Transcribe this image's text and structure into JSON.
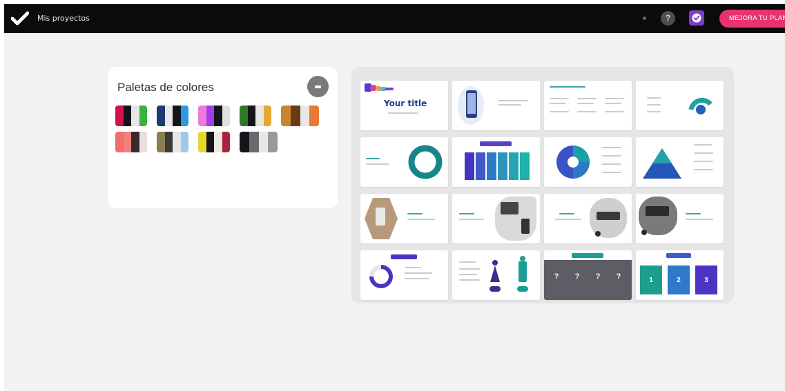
{
  "topbar": {
    "breadcrumb": "Mis proyectos",
    "help_label": "?",
    "upgrade_label": "MEJORA TU PLAN",
    "icons": [
      "check-logo-icon",
      "dot-icon",
      "help-icon",
      "premium-badge-icon"
    ]
  },
  "palettes": {
    "title": "Paletas de colores",
    "more_icon": "more-icon",
    "items": [
      {
        "colors": [
          "#d4114d",
          "#14151b",
          "#e6e6e6",
          "#3bb23b"
        ]
      },
      {
        "colors": [
          "#1e3b70",
          "#e8e8e8",
          "#14151b",
          "#2a9ae0"
        ]
      },
      {
        "colors": [
          "#ee7ad8",
          "#a23ee8",
          "#14151b",
          "#e0e0e0"
        ]
      },
      {
        "colors": [
          "#2e7a2a",
          "#14151b",
          "#e6e6e6",
          "#e5a832"
        ]
      },
      {
        "colors": [
          "#c7862b",
          "#6b3b17",
          "#e8e8e8",
          "#e87a35"
        ]
      },
      {
        "colors": [
          "#f26d6d",
          "#f08080",
          "#3a2a2a",
          "#e8dede"
        ]
      },
      {
        "colors": [
          "#8a7d52",
          "#3b3b33",
          "#e6e6e6",
          "#9ec8e6"
        ]
      },
      {
        "colors": [
          "#e3d92e",
          "#14151b",
          "#ece8dd",
          "#a8233f"
        ]
      },
      {
        "colors": [
          "#14151b",
          "#6b6b6b",
          "#e8e8e8",
          "#9a9a9a"
        ]
      }
    ]
  },
  "templates": {
    "slide1_title": "Your title",
    "slide18_label": "?",
    "slide20_numbers": [
      "1",
      "2",
      "3"
    ]
  }
}
